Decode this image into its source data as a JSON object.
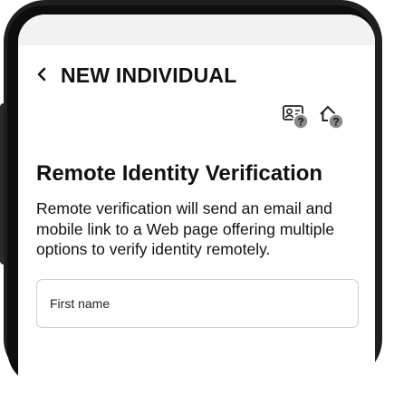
{
  "header": {
    "back_icon": "chevron-left-icon",
    "title": "NEW INDIVIDUAL"
  },
  "help_icons": [
    {
      "name": "id-card-help-icon"
    },
    {
      "name": "home-help-icon"
    }
  ],
  "section": {
    "title": "Remote Identity Verification",
    "description": "Remote verification will send an email and mobile link to a Web page offering multiple options to verify identity remotely."
  },
  "form": {
    "first_name": {
      "placeholder": "First name",
      "value": ""
    }
  },
  "colors": {
    "text": "#111111",
    "field_border": "#cfcfcf",
    "status_bar": "#f2f2f2",
    "phone_frame": "#1f1f1f"
  }
}
